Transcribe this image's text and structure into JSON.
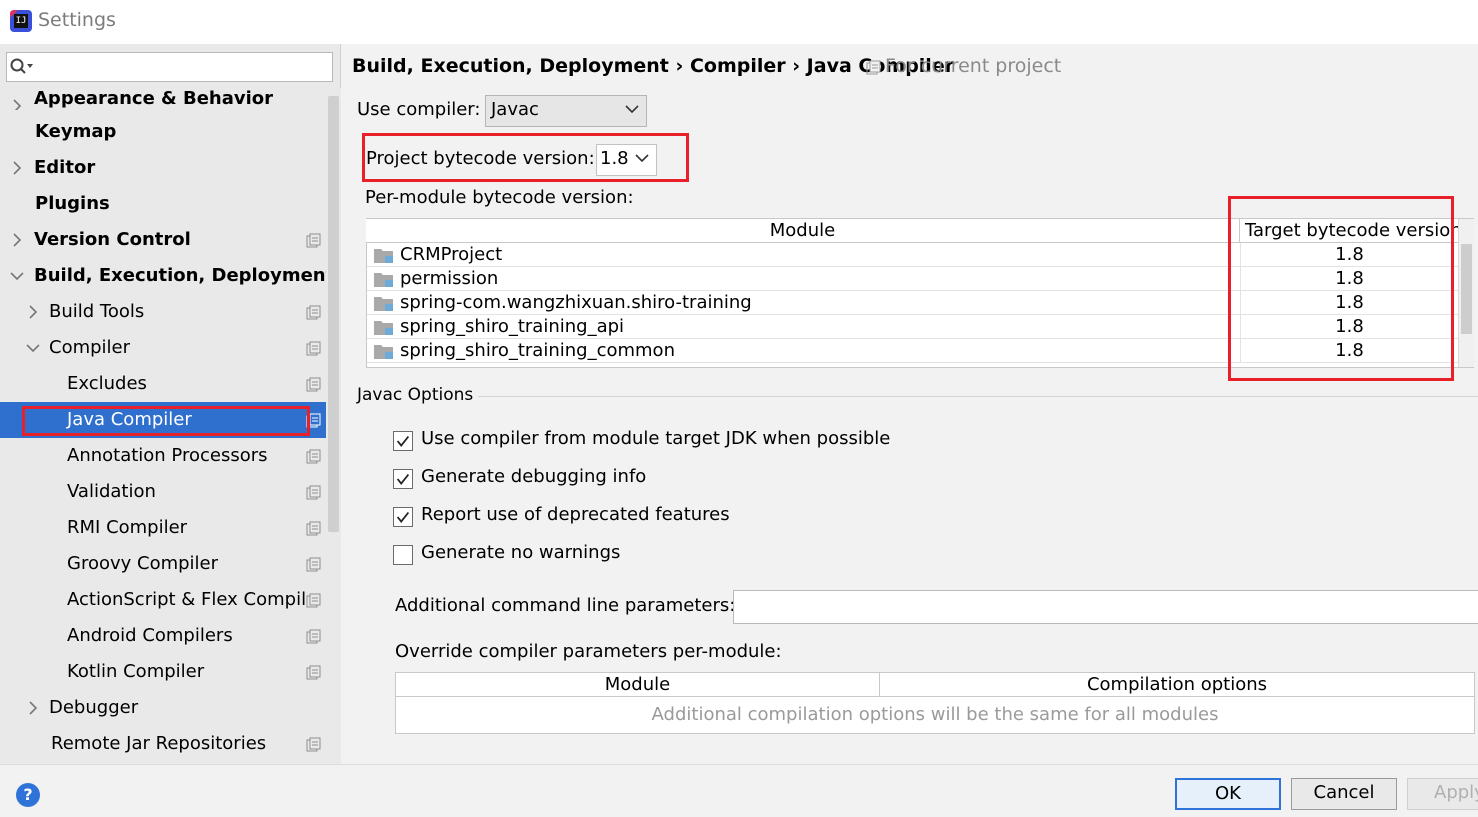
{
  "window": {
    "title": "Settings"
  },
  "sidebar": {
    "search": {
      "placeholder": ""
    },
    "items": [
      {
        "label": "Appearance & Behavior",
        "bold": true,
        "arrow": "right",
        "indent": 0,
        "project": false
      },
      {
        "label": "Keymap",
        "bold": true,
        "arrow": "",
        "indent": 0,
        "project": false
      },
      {
        "label": "Editor",
        "bold": true,
        "arrow": "right",
        "indent": 0,
        "project": false
      },
      {
        "label": "Plugins",
        "bold": true,
        "arrow": "",
        "indent": 0,
        "project": false
      },
      {
        "label": "Version Control",
        "bold": true,
        "arrow": "right",
        "indent": 0,
        "project": true
      },
      {
        "label": "Build, Execution, Deployment",
        "bold": true,
        "arrow": "down",
        "indent": 0,
        "project": false
      },
      {
        "label": "Build Tools",
        "bold": false,
        "arrow": "right",
        "indent": 1,
        "project": true
      },
      {
        "label": "Compiler",
        "bold": false,
        "arrow": "down",
        "indent": 1,
        "project": true
      },
      {
        "label": "Excludes",
        "bold": false,
        "arrow": "",
        "indent": 2,
        "project": true
      },
      {
        "label": "Java Compiler",
        "bold": false,
        "arrow": "",
        "indent": 2,
        "project": true,
        "selected": true
      },
      {
        "label": "Annotation Processors",
        "bold": false,
        "arrow": "",
        "indent": 2,
        "project": true
      },
      {
        "label": "Validation",
        "bold": false,
        "arrow": "",
        "indent": 2,
        "project": true
      },
      {
        "label": "RMI Compiler",
        "bold": false,
        "arrow": "",
        "indent": 2,
        "project": true
      },
      {
        "label": "Groovy Compiler",
        "bold": false,
        "arrow": "",
        "indent": 2,
        "project": true
      },
      {
        "label": "ActionScript & Flex Compil",
        "bold": false,
        "arrow": "",
        "indent": 2,
        "project": true
      },
      {
        "label": "Android Compilers",
        "bold": false,
        "arrow": "",
        "indent": 2,
        "project": true
      },
      {
        "label": "Kotlin Compiler",
        "bold": false,
        "arrow": "",
        "indent": 2,
        "project": true
      },
      {
        "label": "Debugger",
        "bold": false,
        "arrow": "right",
        "indent": 1,
        "project": false
      },
      {
        "label": "Remote Jar Repositories",
        "bold": false,
        "arrow": "",
        "indent": 1,
        "project": true
      }
    ]
  },
  "main": {
    "breadcrumb": "Build, Execution, Deployment › Compiler › Java Compiler",
    "breadcrumb_note": "For current project",
    "use_compiler_label": "Use compiler:",
    "use_compiler_value": "Javac",
    "bytecode_label": "Project bytecode version:",
    "bytecode_value": "1.8",
    "per_module_label": "Per-module bytecode version:",
    "module_table": {
      "headers": [
        "Module",
        "Target bytecode version"
      ],
      "rows": [
        {
          "module": "CRMProject",
          "version": "1.8"
        },
        {
          "module": "permission",
          "version": "1.8"
        },
        {
          "module": "spring-com.wangzhixuan.shiro-training",
          "version": "1.8"
        },
        {
          "module": "spring_shiro_training_api",
          "version": "1.8"
        },
        {
          "module": "spring_shiro_training_common",
          "version": "1.8"
        }
      ]
    },
    "javac_options_title": "Javac Options",
    "checkboxes": [
      {
        "label": "Use compiler from module target JDK when possible",
        "checked": true
      },
      {
        "label": "Generate debugging info",
        "checked": true
      },
      {
        "label": "Report use of deprecated features",
        "checked": true
      },
      {
        "label": "Generate no warnings",
        "checked": false
      }
    ],
    "additional_params_label": "Additional command line parameters:",
    "additional_params_value": "",
    "override_label": "Override compiler parameters per-module:",
    "override_table": {
      "headers": [
        "Module",
        "Compilation options"
      ],
      "empty_text": "Additional compilation options will be the same for all modules"
    }
  },
  "footer": {
    "help": "?",
    "ok": "OK",
    "cancel": "Cancel",
    "apply": "Apply"
  },
  "colors": {
    "selection": "#2f6fcd",
    "highlight_annotation": "#e8202a",
    "folder_module": "#6fa9d8"
  }
}
